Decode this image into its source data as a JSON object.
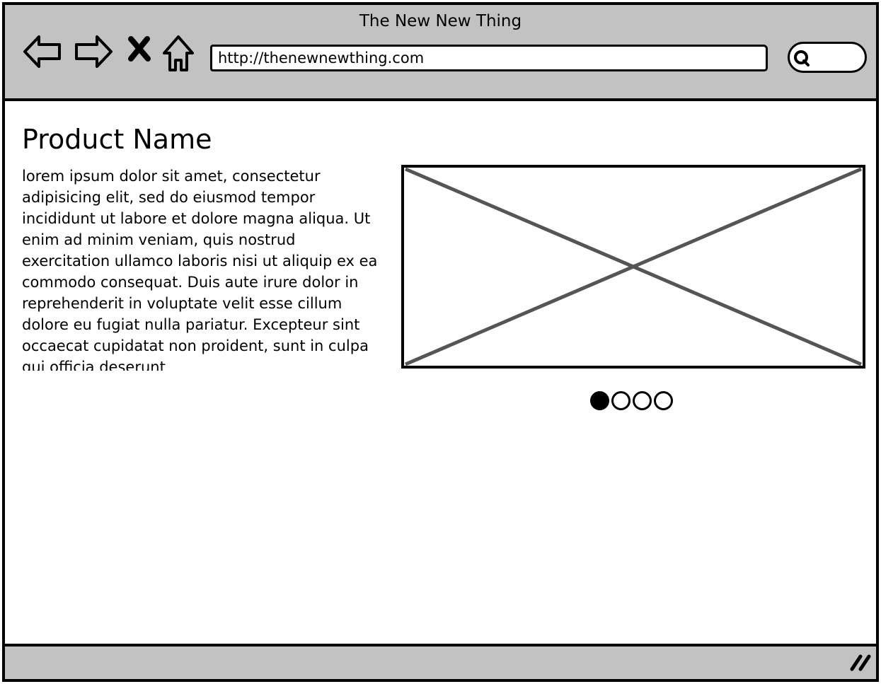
{
  "window": {
    "title": "The New New Thing"
  },
  "toolbar": {
    "url": "http://thenewnewthing.com",
    "icons": {
      "back": "back-arrow-icon",
      "forward": "forward-arrow-icon",
      "stop": "close-icon",
      "home": "home-icon",
      "search": "search-icon"
    }
  },
  "page": {
    "product_title": "Product Name",
    "description": "lorem ipsum dolor sit amet, consectetur adipisicing elit, sed do eiusmod tempor incididunt ut labore et dolore magna aliqua. Ut enim ad minim veniam, quis nostrud exercitation ullamco laboris nisi ut aliquip ex ea commodo consequat. Duis aute irure dolor in reprehenderit in voluptate velit esse cillum dolore eu fugiat nulla pariatur. Excepteur sint occaecat cupidatat non proident, sunt in culpa qui officia deserunt",
    "carousel": {
      "total_dots": 4,
      "active_index": 0
    }
  },
  "status_bar": {
    "icon": "resize-grip-icon"
  },
  "colors": {
    "chrome": "#c2c2c2",
    "stroke": "#000000",
    "placeholder_stroke": "#555555"
  }
}
